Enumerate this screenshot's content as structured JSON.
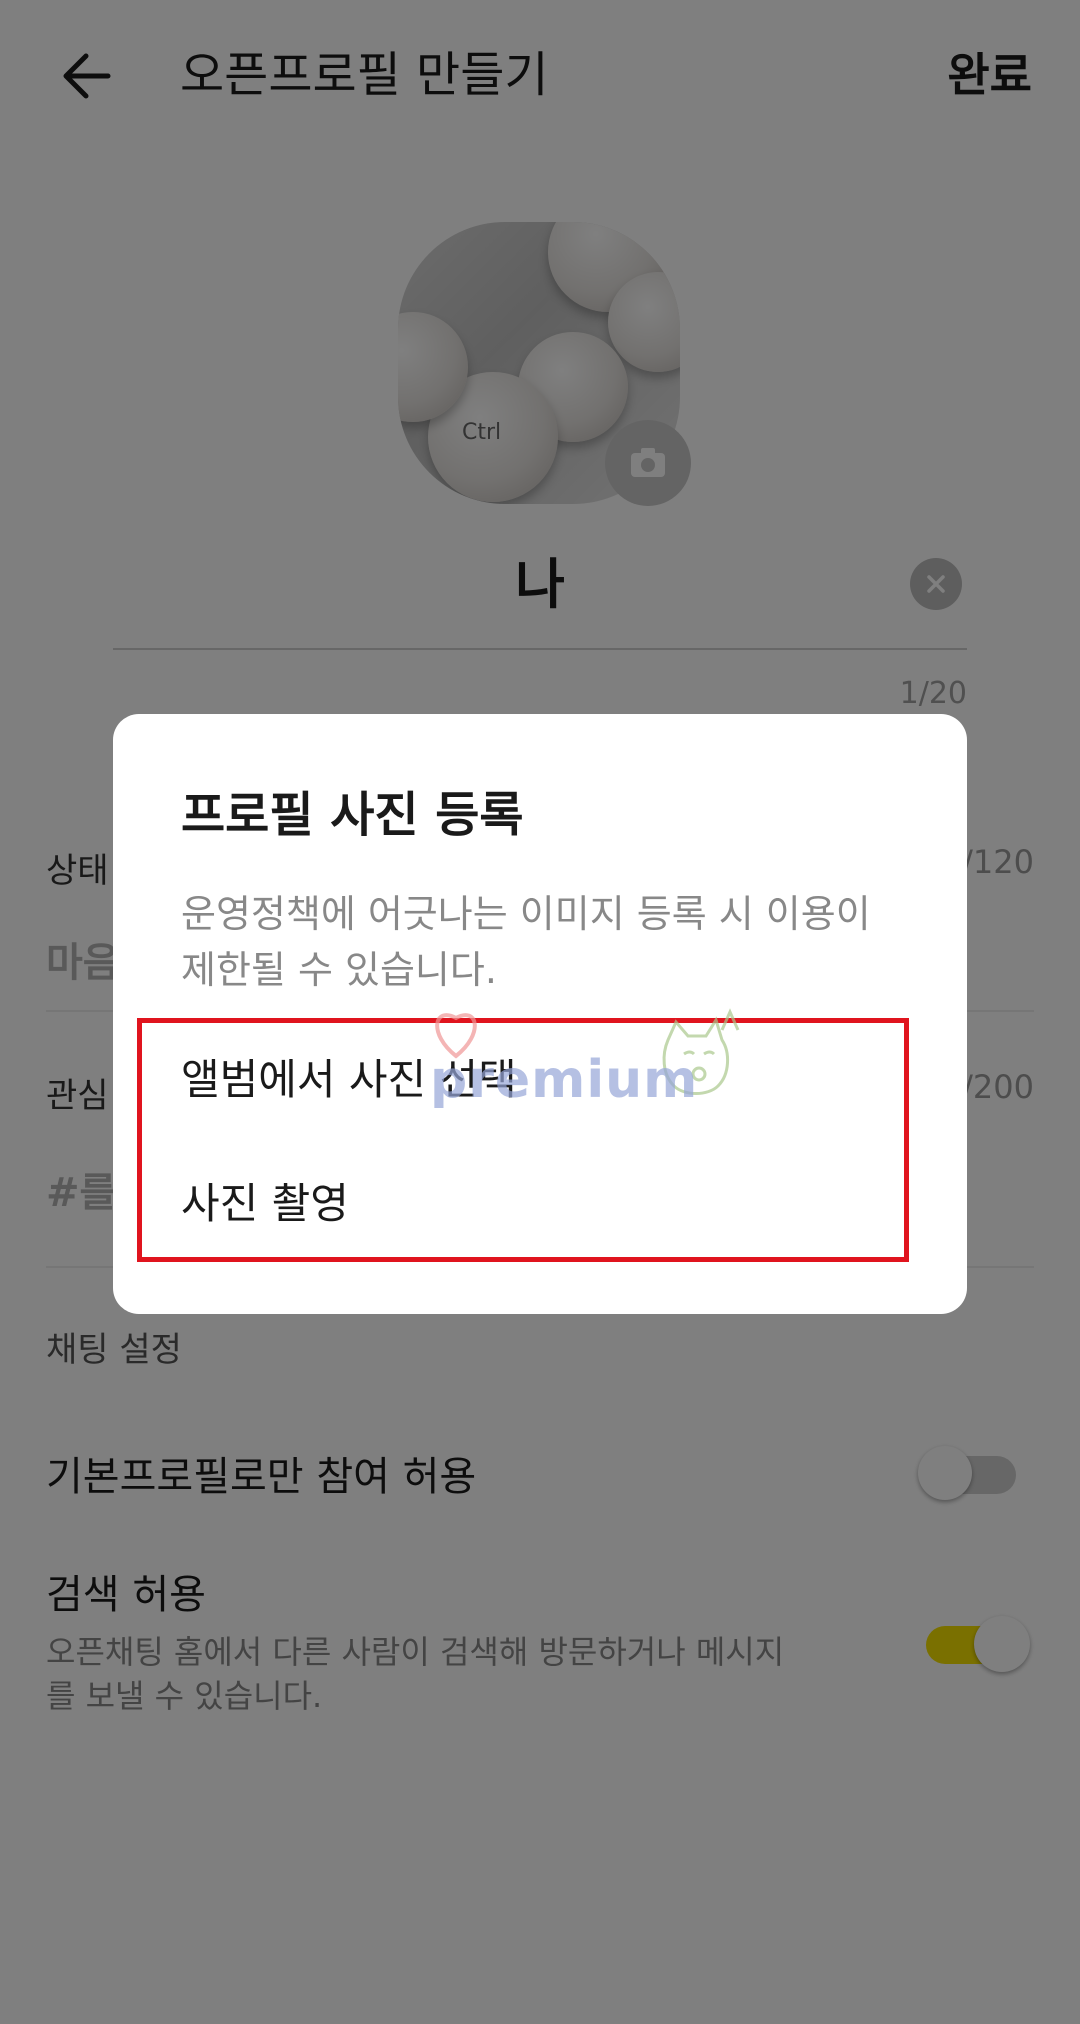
{
  "header": {
    "title": "오픈프로필 만들기",
    "done_label": "완료"
  },
  "avatar": {
    "key_labels": [
      "Ctrl"
    ]
  },
  "name_field": {
    "value": "나",
    "counter": "1/20"
  },
  "status_field": {
    "label": "상태",
    "placeholder": "마음",
    "counter": "/120"
  },
  "interest_field": {
    "label": "관심",
    "placeholder": "#를",
    "counter": "/200"
  },
  "chat_settings": {
    "section_title": "채팅 설정",
    "basic_profile_only": {
      "label": "기본프로필로만 참여 허용",
      "enabled": false
    },
    "allow_search": {
      "label": "검색 허용",
      "description": "오픈채팅 홈에서 다른 사람이 검색해 방문하거나 메시지를 보낼 수 있습니다.",
      "enabled": true
    }
  },
  "dialog": {
    "title": "프로필 사진 등록",
    "message": "운영정책에 어긋나는 이미지 등록 시 이용이 제한될 수 있습니다.",
    "options": [
      "앨범에서 사진 선택",
      "사진 촬영"
    ]
  },
  "watermark": {
    "text": "premium"
  },
  "colors": {
    "toggle_on": "#f5e100",
    "highlight": "#e0141e",
    "scrim": "rgba(0,0,0,0.5)"
  }
}
